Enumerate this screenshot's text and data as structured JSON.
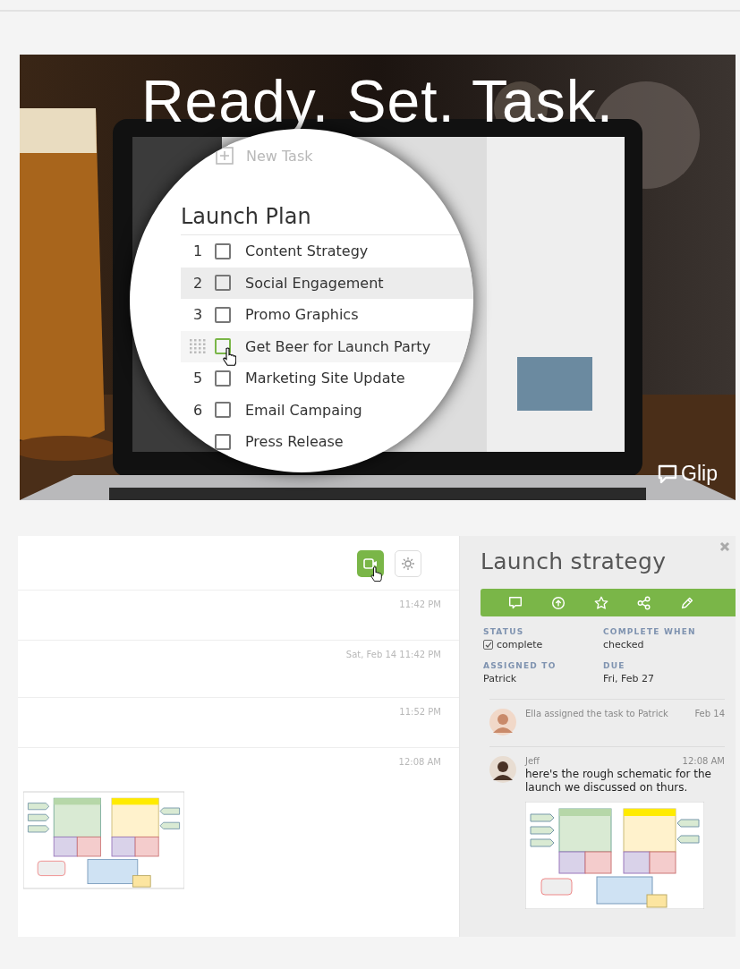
{
  "hero": {
    "headline": "Ready. Set. Task.",
    "brand": "Glip",
    "magnifier": {
      "new_task": "New Task",
      "list_title": "Launch Plan",
      "rows": [
        {
          "number": "1",
          "label": "Content Strategy",
          "checked": false,
          "highlighted": false,
          "hovered": false
        },
        {
          "number": "2",
          "label": "Social Engagement",
          "checked": false,
          "highlighted": true,
          "hovered": false
        },
        {
          "number": "3",
          "label": "Promo Graphics",
          "checked": false,
          "highlighted": false,
          "hovered": false
        },
        {
          "label": "Get Beer for Launch Party",
          "checked": false,
          "highlighted": false,
          "hovered": true
        },
        {
          "number": "5",
          "label": "Marketing Site Update",
          "checked": false,
          "highlighted": false,
          "hovered": false
        },
        {
          "number": "6",
          "label": "Email Campaing",
          "checked": false,
          "highlighted": false,
          "hovered": false
        },
        {
          "label": "Press Release",
          "checked": false,
          "highlighted": false,
          "hovered": false
        }
      ]
    }
  },
  "chat": {
    "timestamps": [
      "11:42 PM",
      "Sat, Feb 14 11:42 PM",
      "11:52 PM",
      "12:08 AM"
    ]
  },
  "task": {
    "title": "Launch strategy",
    "fields": [
      {
        "label": "STATUS",
        "value": "complete",
        "kind": "checkbox",
        "checked": true
      },
      {
        "label": "COMPLETE WHEN",
        "value": "checked",
        "kind": "text"
      },
      {
        "label": "ASSIGNED TO",
        "value": "Patrick",
        "kind": "text"
      },
      {
        "label": "DUE",
        "value": "Fri, Feb 27",
        "kind": "text"
      }
    ],
    "activity": [
      {
        "text": "Ella assigned the task to Patrick",
        "time": "Feb 14",
        "kind": "event"
      },
      {
        "author": "Jeff",
        "text": "here's the rough schematic for the launch we discussed on thurs.",
        "time": "12:08 AM",
        "kind": "message"
      }
    ]
  }
}
